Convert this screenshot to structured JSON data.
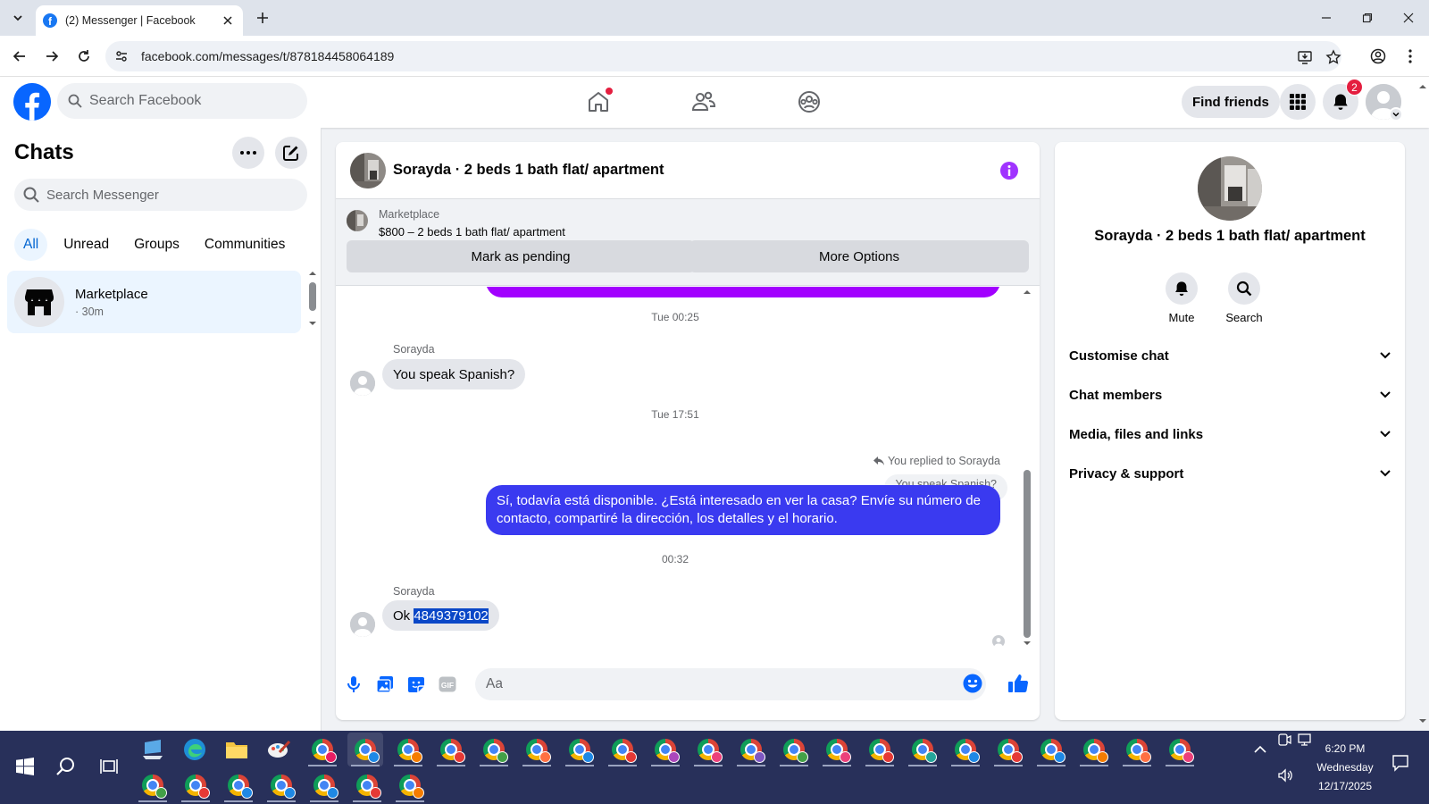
{
  "browser": {
    "tab_title": "(2) Messenger | Facebook",
    "url": "facebook.com/messages/t/878184458064189"
  },
  "facebook": {
    "search_placeholder": "Search Facebook",
    "find_friends": "Find friends",
    "notification_count": "2"
  },
  "chats": {
    "title": "Chats",
    "search_placeholder": "Search Messenger",
    "filters": [
      "All",
      "Unread",
      "Groups",
      "Communities"
    ],
    "active_filter": "All",
    "items": [
      {
        "name": "Marketplace",
        "time": "· 30m"
      }
    ]
  },
  "conversation": {
    "title": "Sorayda · 2 beds 1 bath flat/ apartment",
    "marketplace": {
      "label": "Marketplace",
      "listing": "$800 – 2 beds 1 bath flat/ apartment",
      "mark_pending": "Mark as pending",
      "more_options": "More Options"
    },
    "messages": {
      "ts1": "Tue 00:25",
      "sender1": "Sorayda",
      "msg1": "You speak Spanish?",
      "ts2": "Tue 17:51",
      "reply_context": "You replied to Sorayda",
      "quoted": "You speak Spanish?",
      "out_line1": "Sí, todavía está disponible. ¿Está interesado en ver la casa? Envíe su número de",
      "out_line2": "contacto, compartiré la dirección, los detalles y el horario.",
      "ts3": "00:32",
      "sender2": "Sorayda",
      "msg2_prefix": "Ok ",
      "msg2_selected": "4849379102"
    },
    "composer_placeholder": "Aa"
  },
  "details": {
    "name": "Sorayda · 2 beds 1 bath flat/ apartment",
    "actions": [
      "Mute",
      "Search"
    ],
    "sections": [
      "Customise chat",
      "Chat members",
      "Media, files and links",
      "Privacy & support"
    ]
  },
  "taskbar": {
    "time": "6:20 PM",
    "day": "Wednesday",
    "date": "12/17/2025"
  },
  "colors": {
    "facebook_blue": "#0866ff",
    "outgoing_bubble": "#3a3af0",
    "info_purple": "#a033ff",
    "badge_red": "#e41e3f",
    "taskbar": "#28305a"
  }
}
